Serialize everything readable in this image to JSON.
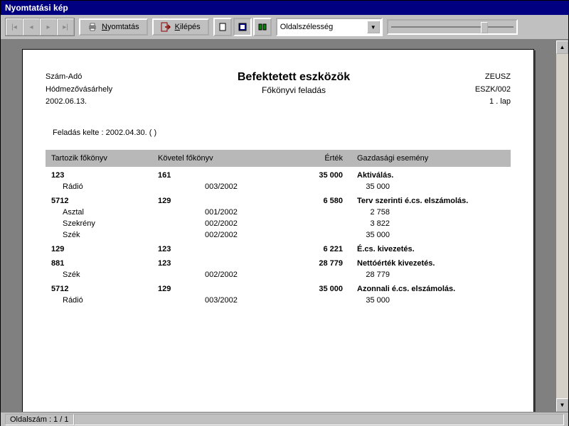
{
  "window": {
    "title": "Nyomtatási kép"
  },
  "toolbar": {
    "print": "Nyomtatás",
    "exit": "Kilépés",
    "zoom_select": "Oldalszélesség"
  },
  "doc": {
    "org1": "Szám-Adó",
    "org2": "Hódmezővásárhely",
    "date": "2002.06.13.",
    "title": "Befektetett eszközök",
    "subtitle": "Főkönyvi feladás",
    "sys": "ZEUSZ",
    "code": "ESZK/002",
    "page": "1 . lap",
    "meta": "Feladás kelte : 2002.04.30. ( )"
  },
  "cols": {
    "c1": "Tartozik főkönyv",
    "c2": "Követel  főkönyv",
    "c3": "Érték",
    "c4": "Gazdasági esemény"
  },
  "rows": [
    {
      "b": true,
      "c1": "123",
      "c2": "161",
      "c3": "35 000",
      "c4": "Aktiválás."
    },
    {
      "b": false,
      "c1": "Rádió",
      "doc": "003/2002",
      "c3": "35 000"
    },
    {
      "b": true,
      "c1": "5712",
      "c2": "129",
      "c3": "6 580",
      "c4": "Terv szerinti é.cs. elszámolás."
    },
    {
      "b": false,
      "c1": "Asztal",
      "doc": "001/2002",
      "c3": "2 758"
    },
    {
      "b": false,
      "c1": "Szekrény",
      "doc": "002/2002",
      "c3": "3 822"
    },
    {
      "b": false,
      "c1": "Szék",
      "doc": "002/2002",
      "c3": "35 000"
    },
    {
      "b": true,
      "c1": "129",
      "c2": "123",
      "c3": "6 221",
      "c4": "É.cs. kivezetés."
    },
    {
      "b": true,
      "c1": "881",
      "c2": "123",
      "c3": "28 779",
      "c4": "Nettóérték kivezetés."
    },
    {
      "b": false,
      "c1": "Szék",
      "doc": "002/2002",
      "c3": "28 779"
    },
    {
      "b": true,
      "c1": "5712",
      "c2": "129",
      "c3": "35 000",
      "c4": "Azonnali é.cs. elszámolás."
    },
    {
      "b": false,
      "c1": "Rádió",
      "doc": "003/2002",
      "c3": "35 000"
    }
  ],
  "status": {
    "page": "Oldalszám : 1 / 1"
  }
}
